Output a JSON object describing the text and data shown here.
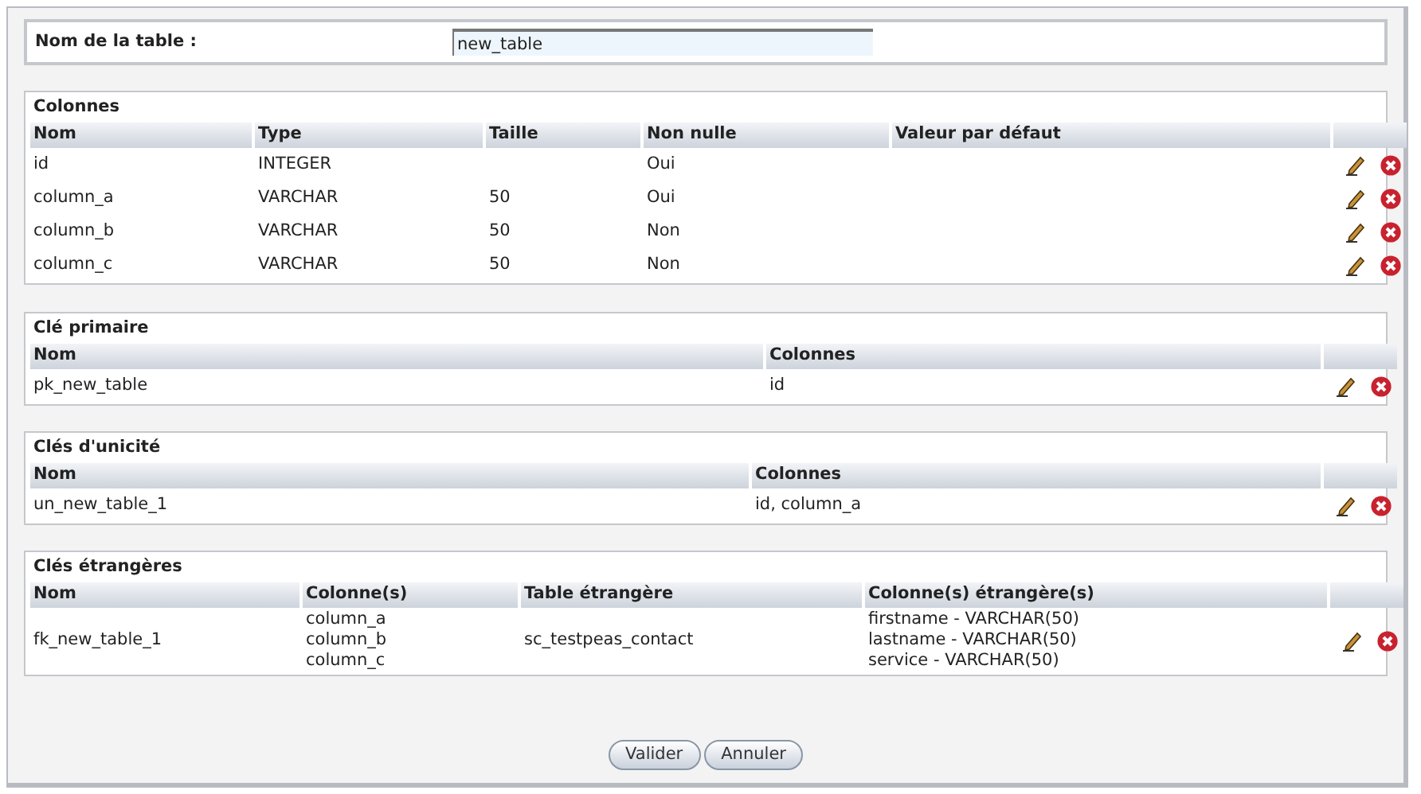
{
  "table_name": {
    "label": "Nom de la table :",
    "value": "new_table"
  },
  "sections": [
    {
      "title": "Colonnes",
      "columns": [
        "Nom",
        "Type",
        "Taille",
        "Non nulle",
        "Valeur par défaut"
      ],
      "rows": [
        {
          "cells": [
            "id",
            "INTEGER",
            "",
            "Oui",
            ""
          ]
        },
        {
          "cells": [
            "column_a",
            "VARCHAR",
            "50",
            "Oui",
            ""
          ]
        },
        {
          "cells": [
            "column_b",
            "VARCHAR",
            "50",
            "Non",
            ""
          ]
        },
        {
          "cells": [
            "column_c",
            "VARCHAR",
            "50",
            "Non",
            ""
          ]
        }
      ]
    },
    {
      "title": "Clé primaire",
      "columns": [
        "Nom",
        "Colonnes"
      ],
      "rows": [
        {
          "cells": [
            "pk_new_table",
            "id"
          ]
        }
      ]
    },
    {
      "title": "Clés d'unicité",
      "columns": [
        "Nom",
        "Colonnes"
      ],
      "rows": [
        {
          "cells": [
            "un_new_table_1",
            "id, column_a"
          ]
        }
      ]
    },
    {
      "title": "Clés étrangères",
      "columns": [
        "Nom",
        "Colonne(s)",
        "Table étrangère",
        "Colonne(s) étrangère(s)"
      ],
      "rows": [
        {
          "cells": [
            "fk_new_table_1",
            [
              "column_a",
              "column_b",
              "column_c"
            ],
            "sc_testpeas_contact",
            [
              "firstname - VARCHAR(50)",
              "lastname - VARCHAR(50)",
              "service - VARCHAR(50)"
            ]
          ]
        }
      ]
    }
  ],
  "buttons": [
    "Valider",
    "Annuler"
  ]
}
